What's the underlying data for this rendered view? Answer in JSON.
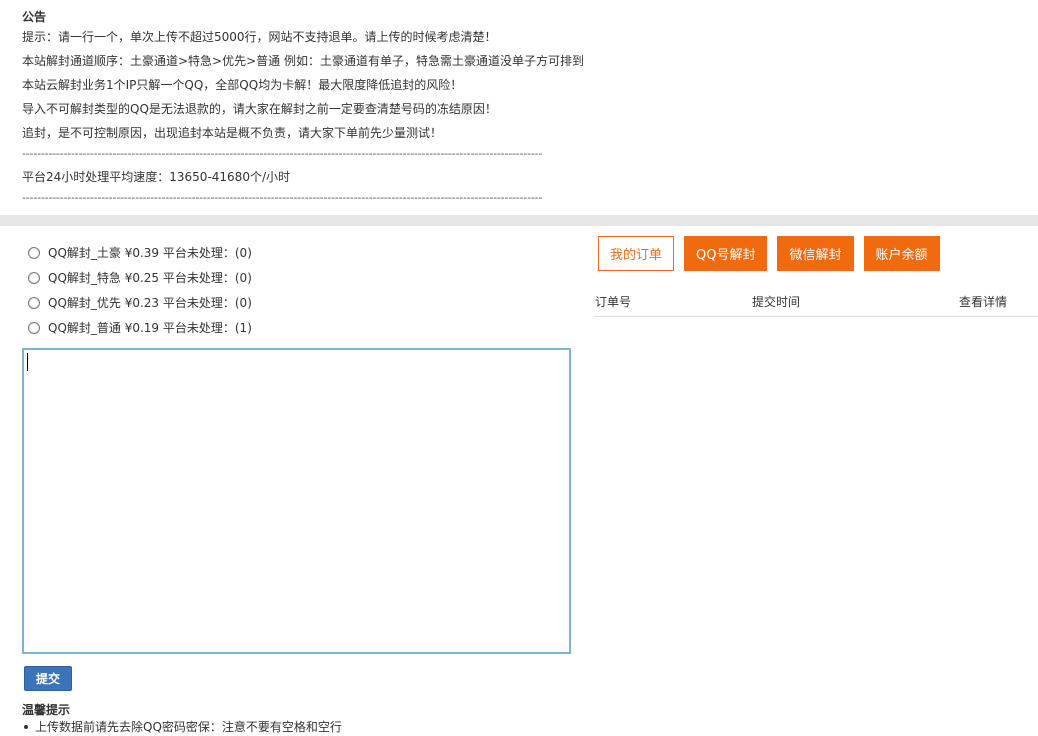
{
  "notice": {
    "title": "公告",
    "lines": [
      "提示：请一行一个，单次上传不超过5000行，网站不支持退单。请上传的时候考虑清楚！",
      "本站解封通道顺序：土豪通道>特急>优先>普通 例如：土豪通道有单子，特急需土豪通道没单子方可排到",
      "本站云解封业务1个IP只解一个QQ，全部QQ均为卡解！最大限度降低追封的风险！",
      "导入不可解封类型的QQ是无法退款的，请大家在解封之前一定要查清楚号码的冻结原因！",
      "追封，是不可控制原因，出现追封本站是概不负责，请大家下单前先少量测试！"
    ],
    "separator": "------------------------------------------------------------------------------------------------------------------------------------------",
    "speed": "平台24小时处理平均速度：13650-41680个/小时"
  },
  "options": [
    "QQ解封_土豪 ¥0.39 平台未处理：(0)",
    "QQ解封_特急 ¥0.25 平台未处理：(0)",
    "QQ解封_优先 ¥0.23 平台未处理：(0)",
    "QQ解封_普通 ¥0.19 平台未处理：(1)"
  ],
  "input": {
    "value": ""
  },
  "submit_label": "提交",
  "tips": {
    "title": "温馨提示",
    "items": [
      "上传数据前请先去除QQ密码密保：注意不要有空格和空行"
    ]
  },
  "tabs": [
    "我的订单",
    "QQ号解封",
    "微信解封",
    "账户余额"
  ],
  "table": {
    "headers": [
      "订单号",
      "提交时间",
      "查看详情"
    ]
  },
  "colors": {
    "accent": "#f26a10",
    "submit": "#3b74b9",
    "textarea_border": "#7fb3d5"
  }
}
